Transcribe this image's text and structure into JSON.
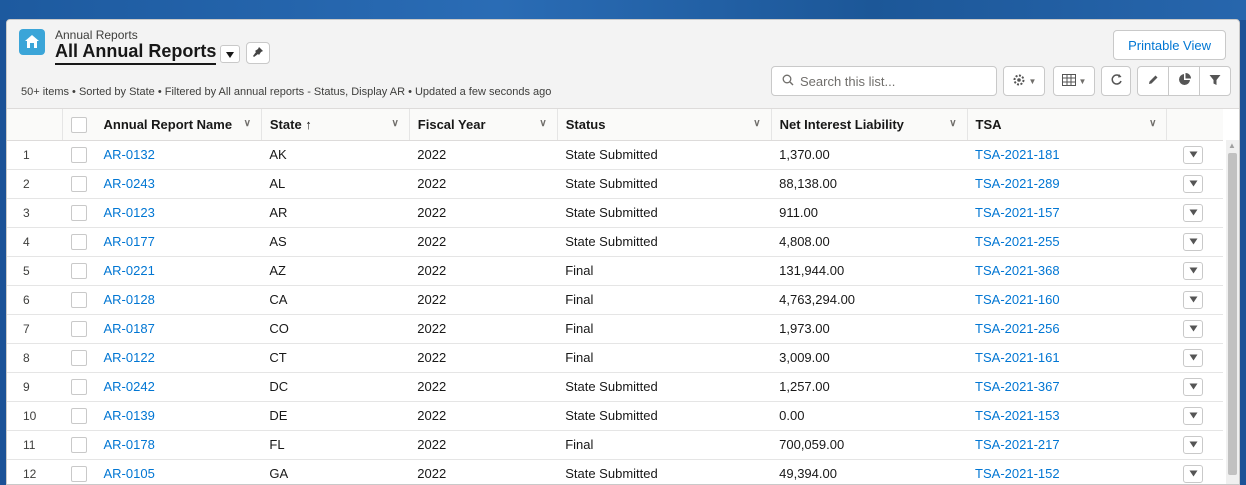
{
  "header": {
    "object_label": "Annual Reports",
    "list_title": "All Annual Reports",
    "printable_label": "Printable View",
    "summary": "50+ items • Sorted by State • Filtered by All annual reports - Status, Display AR • Updated a few seconds ago",
    "search_placeholder": "Search this list..."
  },
  "icons": {
    "object": "home-icon",
    "pin": "pin-icon",
    "settings": "gear-icon",
    "display": "table-grid-icon",
    "refresh": "refresh-icon",
    "edit": "pencil-icon",
    "chart": "pie-chart-icon",
    "filter": "filter-icon"
  },
  "colors": {
    "accent": "#0176d3",
    "icon_bg": "#3ba5d8"
  },
  "table": {
    "columns": [
      {
        "label": "Annual Report Name"
      },
      {
        "label": "State ↑"
      },
      {
        "label": "Fiscal Year"
      },
      {
        "label": "Status"
      },
      {
        "label": "Net Interest Liability"
      },
      {
        "label": "TSA"
      }
    ],
    "rows": [
      {
        "n": "1",
        "name": "AR-0132",
        "state": "AK",
        "year": "2022",
        "status": "State Submitted",
        "nil": "1,370.00",
        "tsa": "TSA-2021-181"
      },
      {
        "n": "2",
        "name": "AR-0243",
        "state": "AL",
        "year": "2022",
        "status": "State Submitted",
        "nil": "88,138.00",
        "tsa": "TSA-2021-289"
      },
      {
        "n": "3",
        "name": "AR-0123",
        "state": "AR",
        "year": "2022",
        "status": "State Submitted",
        "nil": "911.00",
        "tsa": "TSA-2021-157"
      },
      {
        "n": "4",
        "name": "AR-0177",
        "state": "AS",
        "year": "2022",
        "status": "State Submitted",
        "nil": "4,808.00",
        "tsa": "TSA-2021-255"
      },
      {
        "n": "5",
        "name": "AR-0221",
        "state": "AZ",
        "year": "2022",
        "status": "Final",
        "nil": "131,944.00",
        "tsa": "TSA-2021-368"
      },
      {
        "n": "6",
        "name": "AR-0128",
        "state": "CA",
        "year": "2022",
        "status": "Final",
        "nil": "4,763,294.00",
        "tsa": "TSA-2021-160"
      },
      {
        "n": "7",
        "name": "AR-0187",
        "state": "CO",
        "year": "2022",
        "status": "Final",
        "nil": "1,973.00",
        "tsa": "TSA-2021-256"
      },
      {
        "n": "8",
        "name": "AR-0122",
        "state": "CT",
        "year": "2022",
        "status": "Final",
        "nil": "3,009.00",
        "tsa": "TSA-2021-161"
      },
      {
        "n": "9",
        "name": "AR-0242",
        "state": "DC",
        "year": "2022",
        "status": "State Submitted",
        "nil": "1,257.00",
        "tsa": "TSA-2021-367"
      },
      {
        "n": "10",
        "name": "AR-0139",
        "state": "DE",
        "year": "2022",
        "status": "State Submitted",
        "nil": "0.00",
        "tsa": "TSA-2021-153"
      },
      {
        "n": "11",
        "name": "AR-0178",
        "state": "FL",
        "year": "2022",
        "status": "Final",
        "nil": "700,059.00",
        "tsa": "TSA-2021-217"
      },
      {
        "n": "12",
        "name": "AR-0105",
        "state": "GA",
        "year": "2022",
        "status": "State Submitted",
        "nil": "49,394.00",
        "tsa": "TSA-2021-152"
      }
    ]
  }
}
